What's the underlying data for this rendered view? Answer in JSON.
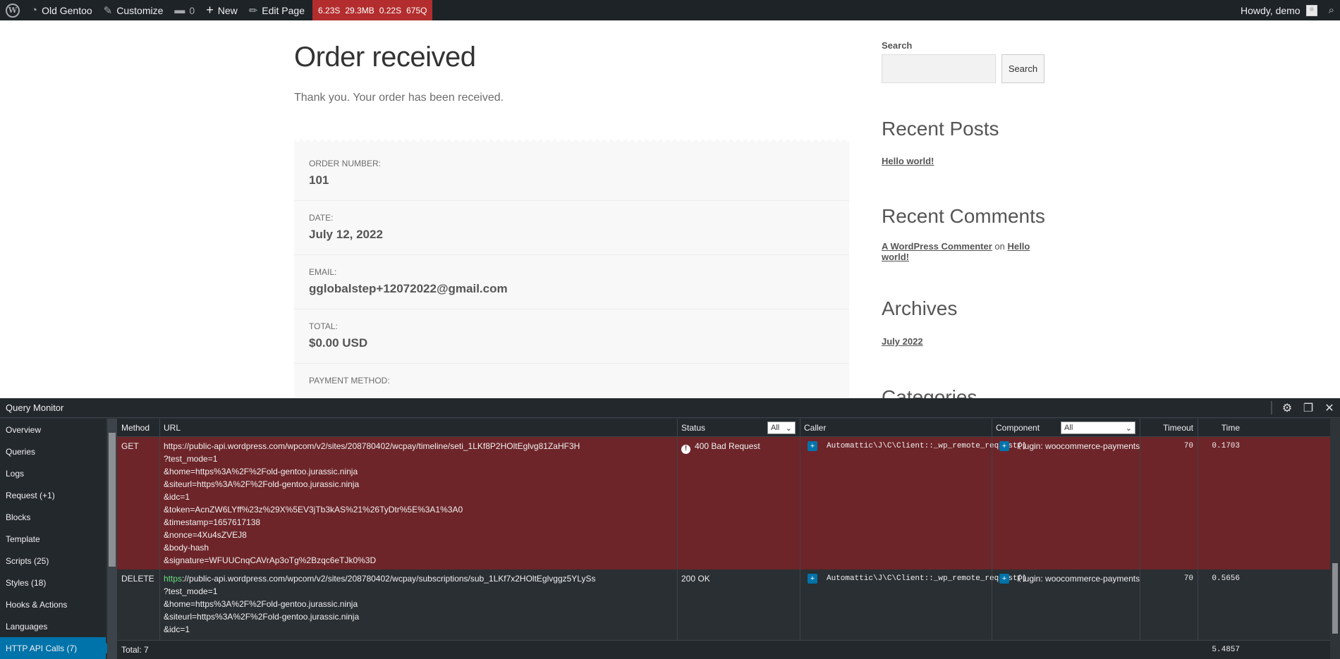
{
  "adminbar": {
    "site_name": "Old Gentoo",
    "customize": "Customize",
    "comments_count": "0",
    "new": "New",
    "edit_page": "Edit Page",
    "qm_time": "6.23S",
    "qm_memory": "29.3MB",
    "qm_db_time": "0.22S",
    "qm_queries": "675Q",
    "howdy": "Howdy, demo"
  },
  "page": {
    "title": "Order received",
    "thanks": "Thank you. Your order has been received.",
    "overview": [
      {
        "label": "ORDER NUMBER:",
        "value": "101"
      },
      {
        "label": "DATE:",
        "value": "July 12, 2022"
      },
      {
        "label": "EMAIL:",
        "value": "gglobalstep+12072022@gmail.com"
      },
      {
        "label": "TOTAL:",
        "value": "$0.00 USD"
      },
      {
        "label": "PAYMENT METHOD:",
        "value": ""
      }
    ]
  },
  "sidebar": {
    "search_label": "Search",
    "search_button": "Search",
    "recent_posts_title": "Recent Posts",
    "recent_post": "Hello world!",
    "recent_comments_title": "Recent Comments",
    "comment_author": "A WordPress Commenter",
    "comment_on": "on",
    "comment_post": "Hello world!",
    "archives_title": "Archives",
    "archive": "July 2022",
    "categories_title": "Categories"
  },
  "qm": {
    "title": "Query Monitor",
    "nav": [
      "Overview",
      "Queries",
      "Logs",
      "Request (+1)",
      "Blocks",
      "Template",
      "Scripts (25)",
      "Styles (18)",
      "Hooks & Actions",
      "Languages",
      "HTTP API Calls (7)"
    ],
    "headers": {
      "method": "Method",
      "url": "URL",
      "status": "Status",
      "status_filter": "All",
      "caller": "Caller",
      "component": "Component",
      "component_filter": "All",
      "timeout": "Timeout",
      "time": "Time"
    },
    "rows": [
      {
        "method": "GET",
        "url_lines": [
          "https://public-api.wordpress.com/wpcom/v2/sites/208780402/wcpay/timeline/seti_1LKf8P2HOltEglvg81ZaHF3H",
          "?test_mode=1",
          "&home=https%3A%2F%2Fold-gentoo.jurassic.ninja",
          "&siteurl=https%3A%2F%2Fold-gentoo.jurassic.ninja",
          "&idc=1",
          "&token=AcnZW6LYff%23z%29X%5EV3jTb3kAS%21%26TyDtr%5E%3A1%3A0",
          "&timestamp=1657617138",
          "&nonce=4Xu4sZVEJ8",
          "&body-hash",
          "&signature=WFUUCnqCAVrAp3oTg%2Bzqc6eTJk0%3D"
        ],
        "status": "400 Bad Request",
        "caller": "Automattic\\J\\C\\Client::_wp_remote_request()",
        "component": "Plugin: woocommerce-payments",
        "timeout": "70",
        "time": "0.1703"
      },
      {
        "method": "DELETE",
        "url_scheme": "https",
        "url_first_rest": "://public-api.wordpress.com/wpcom/v2/sites/208780402/wcpay/subscriptions/sub_1LKf7x2HOltEglvggz5YLySs",
        "url_lines": [
          "?test_mode=1",
          "&home=https%3A%2F%2Fold-gentoo.jurassic.ninja",
          "&siteurl=https%3A%2F%2Fold-gentoo.jurassic.ninja",
          "&idc=1"
        ],
        "status": "200 OK",
        "caller": "Automattic\\J\\C\\Client::_wp_remote_request()",
        "component": "Plugin: woocommerce-payments",
        "timeout": "70",
        "time": "0.5656"
      }
    ],
    "footer_total": "Total: 7",
    "footer_time": "5.4857"
  }
}
